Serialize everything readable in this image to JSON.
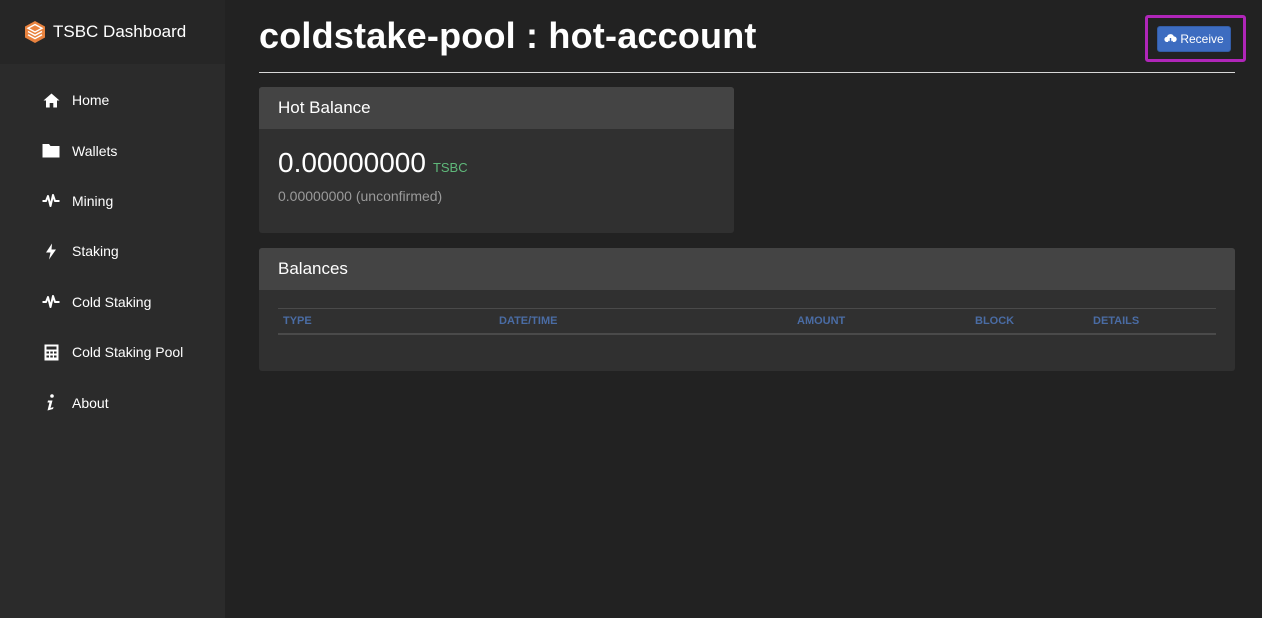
{
  "app": {
    "brand_name": "TSBC Dashboard"
  },
  "sidebar": {
    "items": [
      {
        "label": "Home",
        "icon": "home-icon"
      },
      {
        "label": "Wallets",
        "icon": "folder-icon"
      },
      {
        "label": "Mining",
        "icon": "pulse-icon"
      },
      {
        "label": "Staking",
        "icon": "bolt-icon"
      },
      {
        "label": "Cold Staking",
        "icon": "pulse-icon"
      },
      {
        "label": "Cold Staking Pool",
        "icon": "calculator-icon"
      },
      {
        "label": "About",
        "icon": "info-icon"
      }
    ]
  },
  "header": {
    "title": "coldstake-pool : hot-account",
    "receive_label": "Receive"
  },
  "hot_balance": {
    "title": "Hot Balance",
    "value": "0.00000000",
    "unit": "TSBC",
    "unconfirmed": "0.00000000 (unconfirmed)"
  },
  "balances": {
    "title": "Balances",
    "columns": [
      "TYPE",
      "DATE/TIME",
      "AMOUNT",
      "BLOCK",
      "DETAILS"
    ],
    "rows": []
  },
  "colors": {
    "background": "#222222",
    "sidebar": "#2b2b2b",
    "panel": "#303030",
    "panel_header": "#444444",
    "accent_blue": "#3d6cc0",
    "highlight": "#b026b9",
    "unit_green": "#5fb87a",
    "column_header": "#4a6ca4"
  }
}
